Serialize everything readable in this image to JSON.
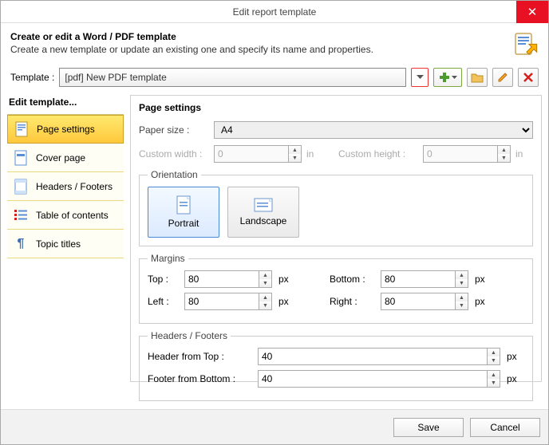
{
  "window": {
    "title": "Edit report template",
    "close": "✕"
  },
  "header": {
    "bold": "Create or edit a Word / PDF template",
    "sub": "Create a new template or update an existing one and specify its name and properties."
  },
  "template": {
    "label": "Template :",
    "value": "[pdf] New PDF template"
  },
  "left": {
    "title": "Edit template...",
    "items": [
      "Page settings",
      "Cover page",
      "Headers / Footers",
      "Table of contents",
      "Topic titles"
    ],
    "selected_index": 0
  },
  "ps": {
    "heading": "Page settings",
    "paper_label": "Paper size :",
    "paper_value": "A4",
    "cw_label": "Custom width :",
    "cw_value": "0",
    "cw_unit": "in",
    "ch_label": "Custom height :",
    "ch_value": "0",
    "ch_unit": "in",
    "orient_legend": "Orientation",
    "portrait": "Portrait",
    "landscape": "Landscape",
    "orient_sel": "portrait",
    "margins_legend": "Margins",
    "top_l": "Top :",
    "top_v": "80",
    "bottom_l": "Bottom :",
    "bottom_v": "80",
    "left_l": "Left :",
    "left_v": "80",
    "right_l": "Right :",
    "right_v": "80",
    "unit": "px",
    "hf_legend": "Headers / Footers",
    "hft_l": "Header from Top :",
    "hft_v": "40",
    "hfb_l": "Footer from Bottom :",
    "hfb_v": "40"
  },
  "footer": {
    "save": "Save",
    "cancel": "Cancel"
  }
}
